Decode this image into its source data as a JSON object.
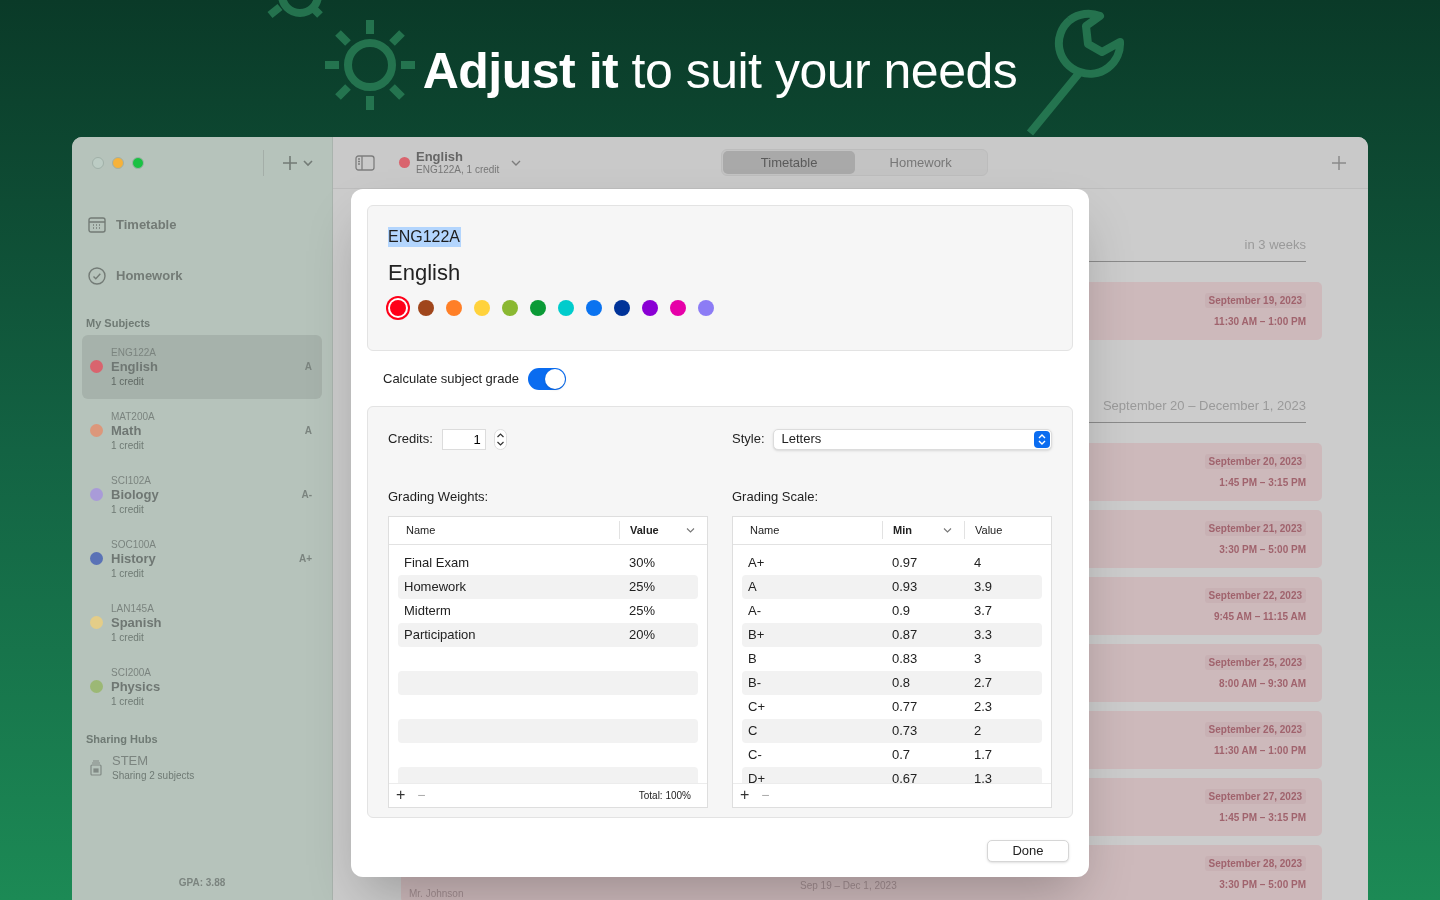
{
  "headline": "**Adjust it** to suit your needs",
  "sidebar": {
    "nav": [
      {
        "kind": "calendar",
        "label": "Timetable"
      },
      {
        "kind": "check",
        "label": "Homework"
      }
    ],
    "subjects_heading": "My Subjects",
    "subjects": [
      {
        "code": "ENG122A",
        "name": "English",
        "credits": "1 credit",
        "grade": "A",
        "color": "#d9646e",
        "selected": true
      },
      {
        "code": "MAT200A",
        "name": "Math",
        "credits": "1 credit",
        "grade": "A",
        "color": "#dc977b",
        "selected": false
      },
      {
        "code": "SCI102A",
        "name": "Biology",
        "credits": "1 credit",
        "grade": "A-",
        "color": "#a99bd8",
        "selected": false
      },
      {
        "code": "SOC100A",
        "name": "History",
        "credits": "1 credit",
        "grade": "A+",
        "color": "#5a72b6",
        "selected": false
      },
      {
        "code": "LAN145A",
        "name": "Spanish",
        "credits": "1 credit",
        "color": "#e4cd88",
        "selected": false
      },
      {
        "code": "SCI200A",
        "name": "Physics",
        "credits": "1 credit",
        "color": "#9cb875",
        "selected": false
      }
    ],
    "hubs_heading": "Sharing Hubs",
    "hubs": [
      {
        "name": "STEM",
        "detail": "Sharing 2 subjects"
      }
    ],
    "gpa": "GPA: 3.88"
  },
  "toolbar": {
    "subject": {
      "name": "English",
      "color": "#d9646e",
      "detail": "ENG122A, 1 credit"
    },
    "tabs": [
      {
        "label": "Timetable",
        "selected": true
      },
      {
        "label": "Homework",
        "selected": false
      }
    ]
  },
  "schedule": [
    {
      "heading": "in 3 weeks",
      "lessons": [
        {
          "date": "September 19, 2023",
          "time": "11:30 AM – 1:00 PM"
        }
      ]
    },
    {
      "heading": "September 20 – December 1, 2023",
      "lessons": [
        {
          "date": "September 20, 2023",
          "time": "1:45 PM – 3:15 PM"
        },
        {
          "date": "September 21, 2023",
          "time": "3:30 PM – 5:00 PM"
        },
        {
          "date": "September 22, 2023",
          "time": "9:45 AM – 11:15 AM"
        },
        {
          "date": "September 25, 2023",
          "time": "8:00 AM – 9:30 AM"
        },
        {
          "date": "September 26, 2023",
          "time": "11:30 AM – 1:00 PM"
        },
        {
          "date": "September 27, 2023",
          "time": "1:45 PM – 3:15 PM"
        },
        {
          "date": "September 28, 2023",
          "time": "3:30 PM – 5:00 PM",
          "teacher": "Mr. Johnson",
          "range": "Sep 19 – Dec 1, 2023"
        }
      ]
    }
  ],
  "dialog": {
    "code": "ENG122A",
    "name": "English",
    "colors": [
      {
        "color": "#ff0019",
        "selected": true
      },
      {
        "color": "#a0461c",
        "selected": false
      },
      {
        "color": "#ff7f27",
        "selected": false
      },
      {
        "color": "#ffd23c",
        "selected": false
      },
      {
        "color": "#8ab832",
        "selected": false
      },
      {
        "color": "#0a9a36",
        "selected": false
      },
      {
        "color": "#00cccc",
        "selected": false
      },
      {
        "color": "#0a73f0",
        "selected": false
      },
      {
        "color": "#003399",
        "selected": false
      },
      {
        "color": "#8a00d4",
        "selected": false
      },
      {
        "color": "#e600a8",
        "selected": false
      },
      {
        "color": "#8c7cf5",
        "selected": false
      }
    ],
    "grade_toggle": {
      "label": "Calculate subject grade",
      "on": true
    },
    "credits_label": "Credits:",
    "credits": "1",
    "style_label": "Style:",
    "style": "Letters",
    "weights": {
      "title": "Grading Weights:",
      "columns": [
        "Name",
        "Value"
      ],
      "rows": [
        {
          "name": "Final Exam",
          "value": "30%"
        },
        {
          "name": "Homework",
          "value": "25%"
        },
        {
          "name": "Midterm",
          "value": "25%"
        },
        {
          "name": "Participation",
          "value": "20%"
        }
      ],
      "add": "+",
      "remove": "−",
      "total": "Total: 100%"
    },
    "scale": {
      "title": "Grading Scale:",
      "columns": [
        "Name",
        "Min",
        "Value"
      ],
      "rows": [
        {
          "name": "A+",
          "min": "0.97",
          "value": "4"
        },
        {
          "name": "A",
          "min": "0.93",
          "value": "3.9"
        },
        {
          "name": "A-",
          "min": "0.9",
          "value": "3.7"
        },
        {
          "name": "B+",
          "min": "0.87",
          "value": "3.3"
        },
        {
          "name": "B",
          "min": "0.83",
          "value": "3"
        },
        {
          "name": "B-",
          "min": "0.8",
          "value": "2.7"
        },
        {
          "name": "C+",
          "min": "0.77",
          "value": "2.3"
        },
        {
          "name": "C",
          "min": "0.73",
          "value": "2"
        },
        {
          "name": "C-",
          "min": "0.7",
          "value": "1.7"
        },
        {
          "name": "D+",
          "min": "0.67",
          "value": "1.3"
        }
      ],
      "add": "+",
      "remove": "−"
    },
    "done": "Done"
  }
}
